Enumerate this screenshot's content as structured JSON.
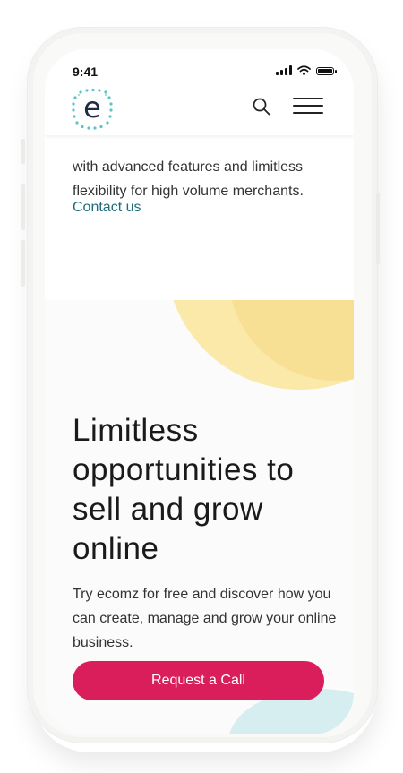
{
  "status_bar": {
    "time": "9:41"
  },
  "header": {
    "logo_letter": "e",
    "brand_color": "#5cc2c7",
    "icons": {
      "search": "search-icon",
      "menu": "hamburger-menu-icon"
    }
  },
  "intro": {
    "text": "with advanced features and limitless flexibility for high volume merchants.",
    "contact_link": "Contact us"
  },
  "hero": {
    "title": "Limitless opportunities to sell and grow online",
    "subtitle": "Try ecomz for free and discover how you can create, manage and grow your online business.",
    "cta_label": "Request a Call"
  },
  "colors": {
    "accent": "#d91e5b",
    "link": "#1f6d7a",
    "blob": "#f7df93"
  }
}
